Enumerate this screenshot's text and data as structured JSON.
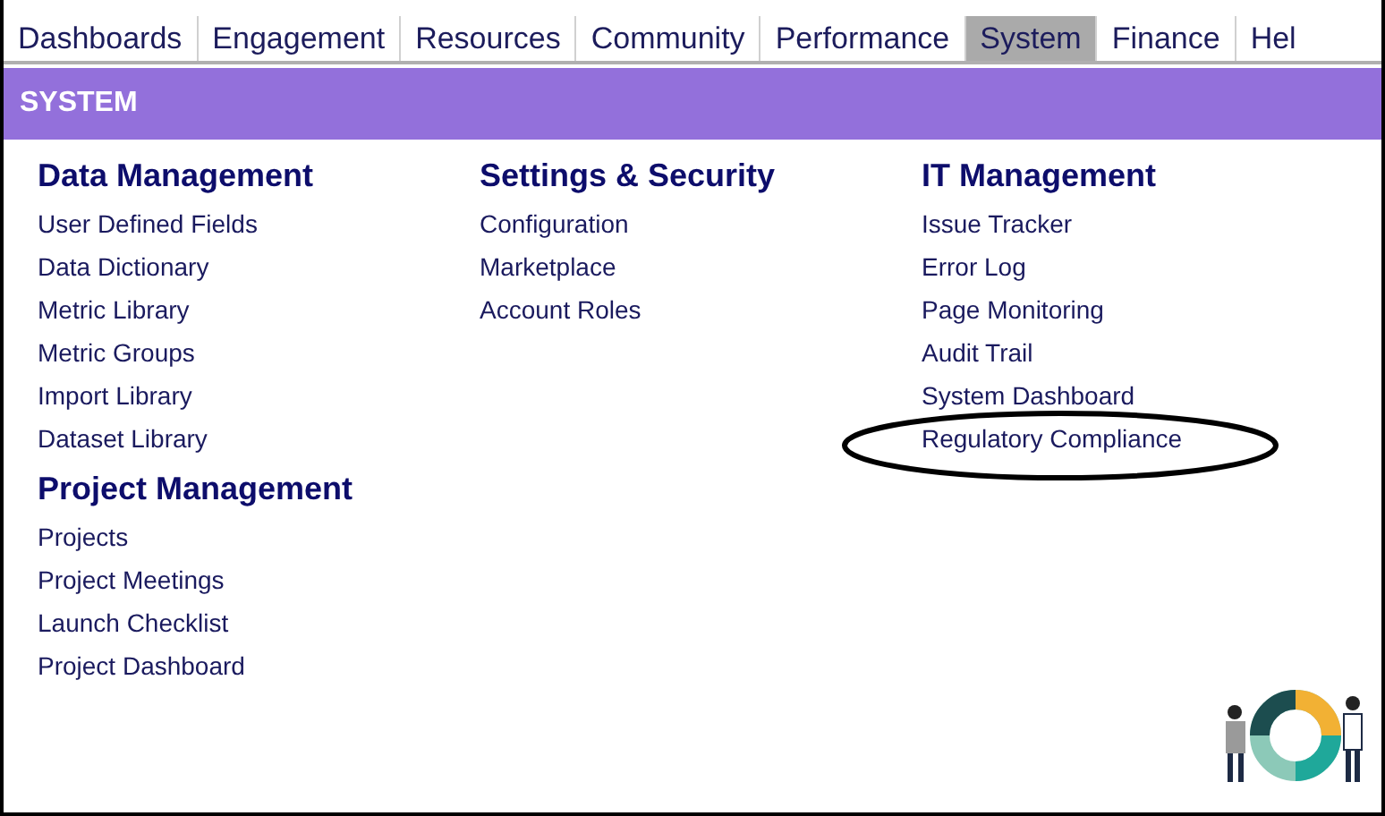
{
  "tabs": [
    {
      "label": "Dashboards",
      "selected": false
    },
    {
      "label": "Engagement",
      "selected": false
    },
    {
      "label": "Resources",
      "selected": false
    },
    {
      "label": "Community",
      "selected": false
    },
    {
      "label": "Performance",
      "selected": false
    },
    {
      "label": "System",
      "selected": true
    },
    {
      "label": "Finance",
      "selected": false
    },
    {
      "label": "Hel",
      "selected": false
    }
  ],
  "banner": {
    "title": "SYSTEM"
  },
  "columns": [
    {
      "sections": [
        {
          "heading": "Data Management",
          "links": [
            "User Defined Fields",
            "Data Dictionary",
            "Metric Library",
            "Metric Groups",
            "Import Library",
            "Dataset Library"
          ]
        },
        {
          "heading": "Project Management",
          "links": [
            "Projects",
            "Project Meetings",
            "Launch Checklist",
            "Project Dashboard"
          ]
        }
      ]
    },
    {
      "sections": [
        {
          "heading": "Settings & Security",
          "links": [
            "Configuration",
            "Marketplace",
            "Account Roles"
          ]
        }
      ]
    },
    {
      "sections": [
        {
          "heading": "IT Management",
          "links": [
            "Issue Tracker",
            "Error Log",
            "Page Monitoring",
            "Audit Trail",
            "System Dashboard",
            "Regulatory Compliance"
          ]
        }
      ]
    }
  ]
}
